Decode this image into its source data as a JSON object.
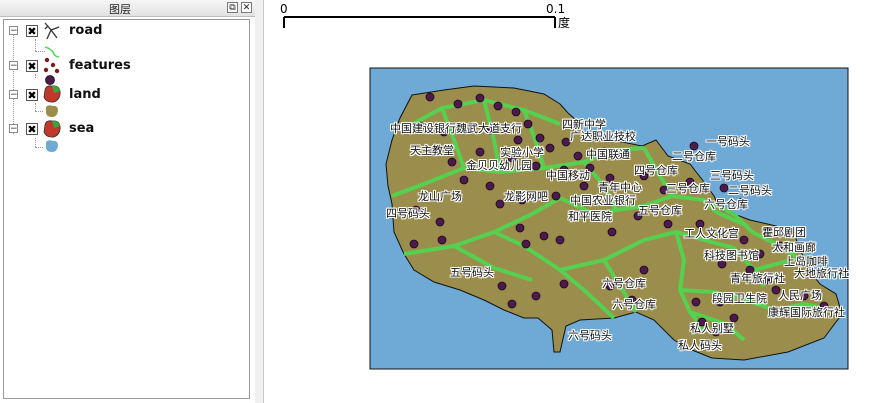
{
  "panel": {
    "title": "图层",
    "float_btn": "⧉",
    "close_btn": "✕"
  },
  "layers": [
    {
      "name": "road",
      "checked": "✖",
      "icon": "road-icon"
    },
    {
      "name": "features",
      "checked": "✖",
      "icon": "features-icon"
    },
    {
      "name": "land",
      "checked": "✖",
      "icon": "land-icon"
    },
    {
      "name": "sea",
      "checked": "✖",
      "icon": "sea-icon"
    }
  ],
  "scale_bar": {
    "start": "0",
    "end": "0.1",
    "unit": "度"
  },
  "colors": {
    "sea": "#6fa9d6",
    "land": "#9b8e4c",
    "road": "#55d14f",
    "feature": "#4d1a4e"
  },
  "map_labels": [
    {
      "text": "四新中学"
    },
    {
      "text": "中国建设银行魏武大道支行"
    },
    {
      "text": "广达职业技校"
    },
    {
      "text": "一号码头"
    },
    {
      "text": "天主教堂"
    },
    {
      "text": "中国联通"
    },
    {
      "text": "二号仓库"
    },
    {
      "text": "实验小学"
    },
    {
      "text": "金贝贝幼儿园"
    },
    {
      "text": "四号仓库"
    },
    {
      "text": "三号码头"
    },
    {
      "text": "中国移动"
    },
    {
      "text": "青年中心"
    },
    {
      "text": "三号仓库"
    },
    {
      "text": "二号码头"
    },
    {
      "text": "龙山广场"
    },
    {
      "text": "龙影网吧"
    },
    {
      "text": "中国农业银行"
    },
    {
      "text": "六号仓库"
    },
    {
      "text": "四号码头"
    },
    {
      "text": "五号仓库"
    },
    {
      "text": "和平医院"
    },
    {
      "text": "霍邱剧团"
    },
    {
      "text": "工人文化宫"
    },
    {
      "text": "太和画廊"
    },
    {
      "text": "科技图书馆"
    },
    {
      "text": "上岛咖啡"
    },
    {
      "text": "五号码头"
    },
    {
      "text": "大地旅行社"
    },
    {
      "text": "青年旅行社"
    },
    {
      "text": "六号仓库"
    },
    {
      "text": "人民广场"
    },
    {
      "text": "段园卫生院"
    },
    {
      "text": "六号仓库"
    },
    {
      "text": "康辉国际旅行社"
    },
    {
      "text": "私人别墅"
    },
    {
      "text": "六号码头"
    },
    {
      "text": "私人码头"
    }
  ]
}
